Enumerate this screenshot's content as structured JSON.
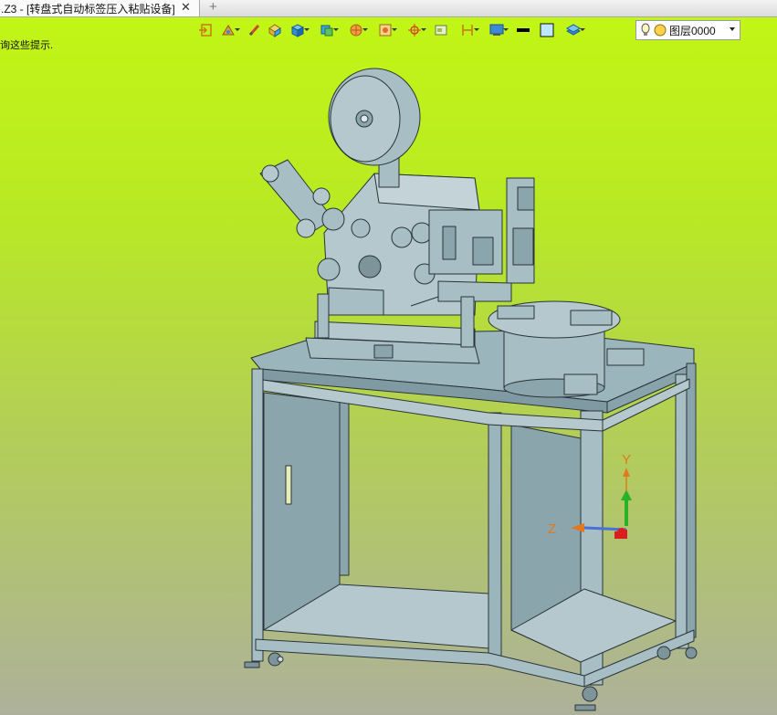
{
  "tab": {
    "title": ".Z3 - [转盘式自动标签压入粘贴设备]",
    "close_icon": "close-icon",
    "add_icon": "plus-icon"
  },
  "hint_text": "询这些提示.",
  "toolbar": {
    "buttons": [
      {
        "name": "exit-sketch-icon",
        "dropdown": false
      },
      {
        "name": "sketch-style-icon",
        "dropdown": true
      },
      {
        "name": "brush-icon",
        "dropdown": false
      },
      {
        "name": "solid-icon",
        "dropdown": false
      },
      {
        "name": "cube-blue-icon",
        "dropdown": true
      },
      {
        "name": "view-cube-icon",
        "dropdown": true
      },
      {
        "name": "section-view-icon",
        "dropdown": true
      },
      {
        "name": "image-frame-icon",
        "dropdown": true
      },
      {
        "name": "crosshair-icon",
        "dropdown": true
      },
      {
        "name": "light-panel-icon",
        "dropdown": false
      },
      {
        "name": "dimension-icon",
        "dropdown": true
      },
      {
        "name": "background-display-icon",
        "dropdown": true
      },
      {
        "name": "line-weight-icon",
        "dropdown": false
      },
      {
        "name": "color-swatch-icon",
        "dropdown": false
      },
      {
        "name": "layer-stack-icon",
        "dropdown": true
      }
    ]
  },
  "layer": {
    "bulb_icon": "lightbulb-icon",
    "color_icon": "yellow-circle-icon",
    "value": "图层0000"
  },
  "triad": {
    "y_label": "Y",
    "z_label": "Z"
  },
  "colors": {
    "model": "#9bb5bc",
    "model_dark": "#6d8790",
    "outline": "#2a3438",
    "axis_y": "#27b327",
    "axis_z": "#e07a1c",
    "axis_x": "#d91e1e"
  }
}
